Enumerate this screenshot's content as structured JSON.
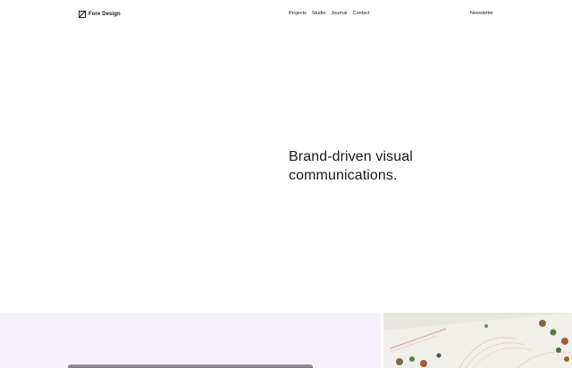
{
  "header": {
    "brand": "Fore Design",
    "nav": [
      {
        "label": "Projects"
      },
      {
        "label": "Studio"
      },
      {
        "label": "Journal"
      },
      {
        "label": "Contact"
      }
    ],
    "newsletter_label": "Newsletter"
  },
  "hero": {
    "headline": "Brand-driven visual communications."
  },
  "projects": [
    {
      "tile_color": "#f5f0fb"
    },
    {
      "tile_color": "#e9e7e1"
    }
  ]
}
